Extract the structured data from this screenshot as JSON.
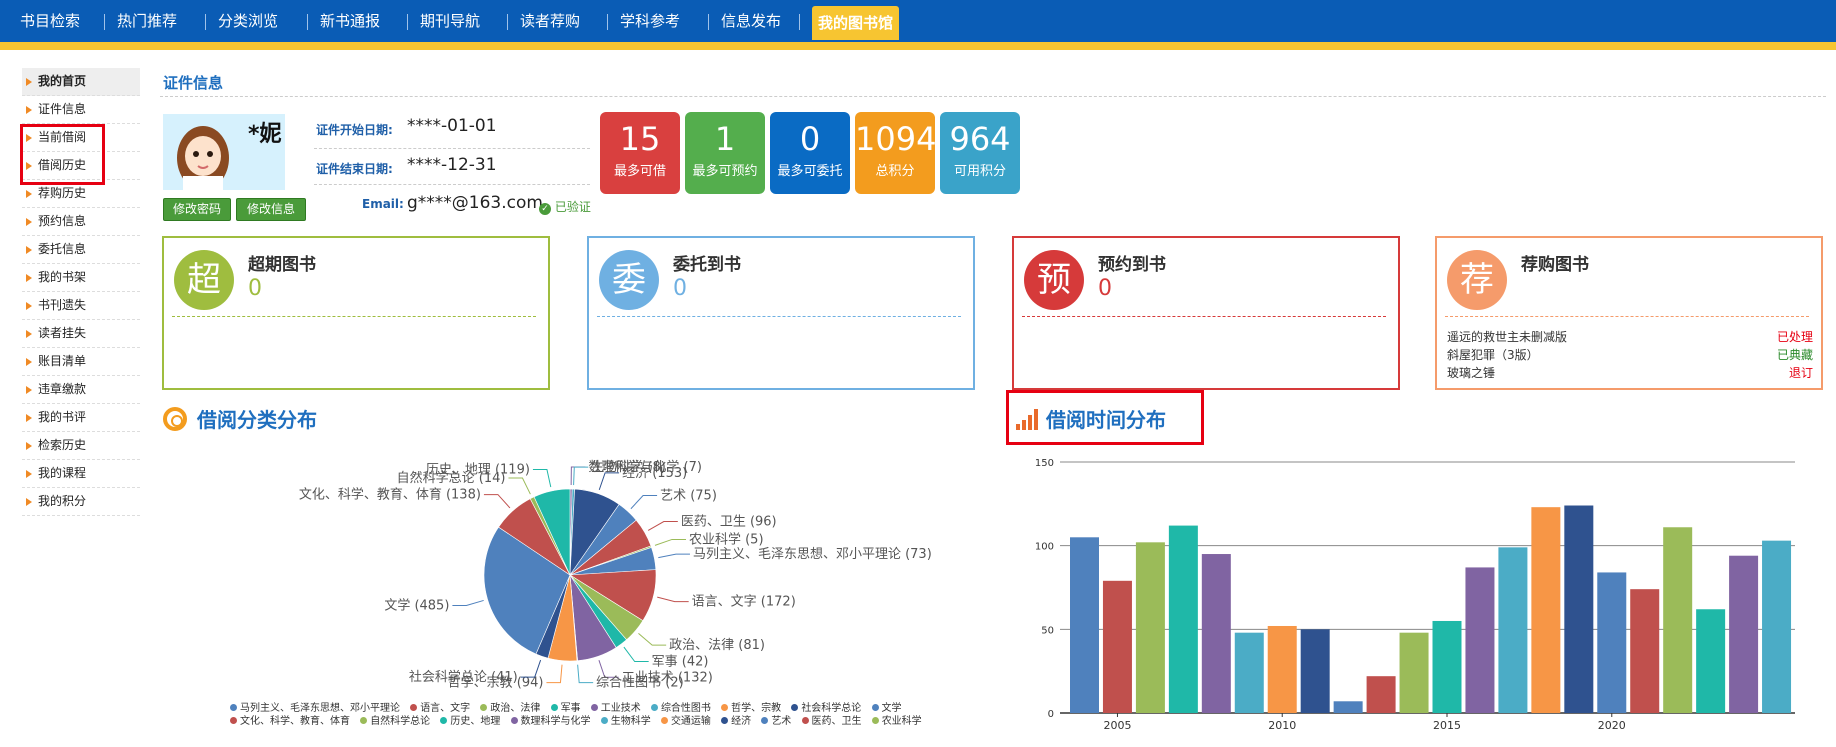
{
  "nav": {
    "items": [
      "书目检索",
      "热门推荐",
      "分类浏览",
      "新书通报",
      "期刊导航",
      "读者荐购",
      "学科参考",
      "信息发布",
      "我的图书馆"
    ],
    "active": "我的图书馆"
  },
  "sidebar": {
    "items": [
      "我的首页",
      "证件信息",
      "当前借阅",
      "借阅历史",
      "荐购历史",
      "预约信息",
      "委托信息",
      "我的书架",
      "书刊遗失",
      "读者挂失",
      "账目清单",
      "违章缴款",
      "我的书评",
      "检索历史",
      "我的课程",
      "我的积分"
    ]
  },
  "cert": {
    "title": "证件信息",
    "name": "*妮",
    "start_label": "证件开始日期:",
    "start_value": "****-01-01",
    "end_label": "证件结束日期:",
    "end_value": "****-12-31",
    "email_label": "Email:",
    "email_value": "g****@163.com",
    "verified": "已验证",
    "btn_pwd": "修改密码",
    "btn_info": "修改信息"
  },
  "stats": [
    {
      "num": "15",
      "label": "最多可借",
      "color": "#d9403f"
    },
    {
      "num": "1",
      "label": "最多可预约",
      "color": "#54ae4d"
    },
    {
      "num": "0",
      "label": "最多可委托",
      "color": "#0a6bc4"
    },
    {
      "num": "1094",
      "label": "总积分",
      "color": "#f39c1e"
    },
    {
      "num": "964",
      "label": "可用积分",
      "color": "#3aa3c9"
    }
  ],
  "cards": [
    {
      "char": "超",
      "title": "超期图书",
      "value": "0",
      "color": "#9fbd3f"
    },
    {
      "char": "委",
      "title": "委托到书",
      "value": "0",
      "color": "#6fb0e2"
    },
    {
      "char": "预",
      "title": "预约到书",
      "value": "0",
      "color": "#d63a3a"
    },
    {
      "char": "荐",
      "title": "荐购图书",
      "value": "",
      "color": "#f59b6b"
    }
  ],
  "recommend": [
    {
      "title": "遥远的救世主未删减版",
      "status": "已处理",
      "color": "#e60012"
    },
    {
      "title": "斜屋犯罪（3版）",
      "status": "已典藏",
      "color": "#2a8a2a"
    },
    {
      "title": "玻璃之锤",
      "status": "退订",
      "color": "#e60012"
    }
  ],
  "section_titles": {
    "category": "借阅分类分布",
    "time": "借阅时间分布"
  },
  "chart_data": [
    {
      "type": "pie",
      "title": "借阅分类分布",
      "slices": [
        {
          "label": "数理科学与化学",
          "value": 7,
          "color": "#8064a2"
        },
        {
          "label": "生物科学",
          "value": 8,
          "color": "#4bacc6"
        },
        {
          "label": "经济",
          "value": 153,
          "color": "#2f528f"
        },
        {
          "label": "艺术",
          "value": 75,
          "color": "#4f81bd"
        },
        {
          "label": "医药、卫生",
          "value": 96,
          "color": "#c0504d"
        },
        {
          "label": "农业科学",
          "value": 5,
          "color": "#9bbb59"
        },
        {
          "label": "马列主义、毛泽东思想、邓小平理论",
          "value": 73,
          "color": "#4f81bd"
        },
        {
          "label": "语言、文字",
          "value": 172,
          "color": "#c0504d"
        },
        {
          "label": "政治、法律",
          "value": 81,
          "color": "#9bbb59"
        },
        {
          "label": "军事",
          "value": 42,
          "color": "#1fb8a8"
        },
        {
          "label": "工业技术",
          "value": 132,
          "color": "#8064a2"
        },
        {
          "label": "综合性图书",
          "value": 2,
          "color": "#4bacc6"
        },
        {
          "label": "哲学、宗教",
          "value": 94,
          "color": "#f79646"
        },
        {
          "label": "社会科学总论",
          "value": 41,
          "color": "#2f528f"
        },
        {
          "label": "文学",
          "value": 485,
          "color": "#4f81bd"
        },
        {
          "label": "文化、科学、教育、体育",
          "value": 138,
          "color": "#c0504d"
        },
        {
          "label": "自然科学总论",
          "value": 14,
          "color": "#9bbb59"
        },
        {
          "label": "历史、地理",
          "value": 119,
          "color": "#1fb8a8"
        }
      ],
      "legend": [
        {
          "label": "马列主义、毛泽东思想、邓小平理论",
          "color": "#4f81bd"
        },
        {
          "label": "语言、文字",
          "color": "#c0504d"
        },
        {
          "label": "政治、法律",
          "color": "#9bbb59"
        },
        {
          "label": "军事",
          "color": "#1fb8a8"
        },
        {
          "label": "工业技术",
          "color": "#8064a2"
        },
        {
          "label": "综合性图书",
          "color": "#4bacc6"
        },
        {
          "label": "哲学、宗教",
          "color": "#f79646"
        },
        {
          "label": "社会科学总论",
          "color": "#2f528f"
        },
        {
          "label": "文学",
          "color": "#4f81bd"
        },
        {
          "label": "文化、科学、教育、体育",
          "color": "#c0504d"
        },
        {
          "label": "自然科学总论",
          "color": "#9bbb59"
        },
        {
          "label": "历史、地理",
          "color": "#1fb8a8"
        },
        {
          "label": "数理科学与化学",
          "color": "#8064a2"
        },
        {
          "label": "生物科学",
          "color": "#4bacc6"
        },
        {
          "label": "交通运输",
          "color": "#f79646"
        },
        {
          "label": "经济",
          "color": "#2f528f"
        },
        {
          "label": "艺术",
          "color": "#4f81bd"
        },
        {
          "label": "医药、卫生",
          "color": "#c0504d"
        },
        {
          "label": "农业科学",
          "color": "#9bbb59"
        }
      ]
    },
    {
      "type": "bar",
      "title": "借阅时间分布",
      "x": [
        2004,
        2005,
        2006,
        2007,
        2008,
        2009,
        2010,
        2011,
        2012,
        2013,
        2014,
        2015,
        2016,
        2017,
        2018,
        2019,
        2020,
        2021,
        2022,
        2023,
        2024
      ],
      "values": [
        105,
        79,
        102,
        112,
        95,
        48,
        52,
        50,
        7,
        22,
        48,
        55,
        87,
        99,
        123,
        124,
        84,
        74,
        111,
        62,
        94,
        103
      ],
      "colors": [
        "#4f81bd",
        "#c0504d",
        "#9bbb59",
        "#1fb8a8",
        "#8064a2",
        "#4bacc6",
        "#f79646",
        "#2f528f",
        "#4f81bd",
        "#c0504d",
        "#9bbb59",
        "#1fb8a8",
        "#8064a2",
        "#4bacc6",
        "#f79646",
        "#2f528f",
        "#4f81bd",
        "#c0504d",
        "#9bbb59",
        "#1fb8a8",
        "#8064a2",
        "#4bacc6"
      ],
      "xticks": [
        "2005",
        "2010",
        "2015",
        "2020"
      ],
      "yticks": [
        "0",
        "50",
        "100",
        "150"
      ],
      "ylim": [
        0,
        150
      ]
    }
  ]
}
